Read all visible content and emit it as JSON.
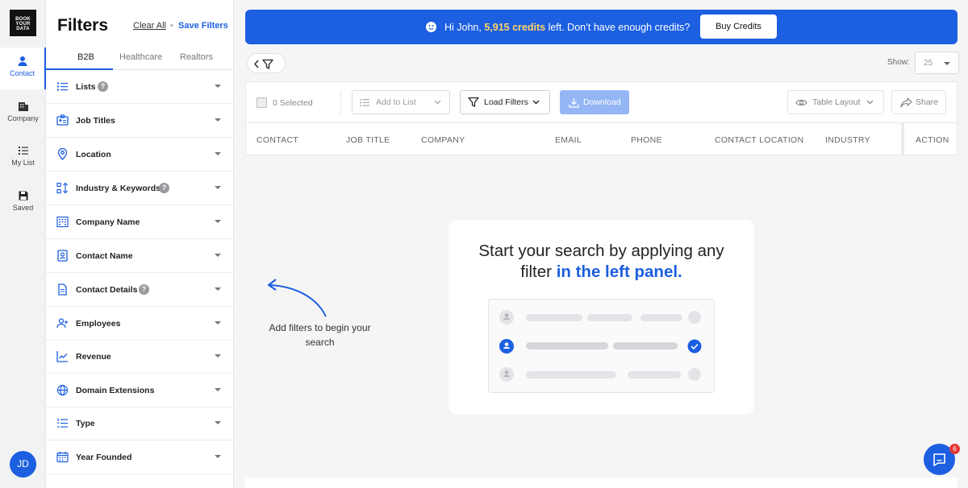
{
  "logo": {
    "text": "BOOK YOUR DATA"
  },
  "rail": {
    "items": [
      {
        "label": "Contact"
      },
      {
        "label": "Company"
      },
      {
        "label": "My List"
      },
      {
        "label": "Saved"
      }
    ],
    "avatar": "JD"
  },
  "filters": {
    "title": "Filters",
    "clear_all": "Clear All",
    "separator": "•",
    "save": "Save Filters",
    "tabs": [
      "B2B",
      "Healthcare",
      "Realtors"
    ],
    "items": [
      {
        "label": "Lists",
        "help": "?"
      },
      {
        "label": "Job Titles"
      },
      {
        "label": "Location"
      },
      {
        "label": "Industry & Keywords",
        "help": "?"
      },
      {
        "label": "Company Name"
      },
      {
        "label": "Contact Name"
      },
      {
        "label": "Contact Details",
        "help": "?"
      },
      {
        "label": "Employees"
      },
      {
        "label": "Revenue"
      },
      {
        "label": "Domain Extensions"
      },
      {
        "label": "Type"
      },
      {
        "label": "Year Founded"
      }
    ]
  },
  "banner": {
    "greeting": "Hi John, ",
    "credits": "5,915 credits",
    "tail": " left. Don’t have enough credits?",
    "buy": "Buy Credits"
  },
  "pager": {
    "show_label": "Show:",
    "show_value": "25"
  },
  "toolbar": {
    "selected": "0 Selected",
    "add_to_list": "Add to List",
    "load_filters": "Load Filters",
    "download": "Download",
    "table_layout": "Table Layout",
    "share": "Share"
  },
  "columns": [
    "CONTACT",
    "JOB TITLE",
    "COMPANY",
    "EMAIL",
    "PHONE",
    "CONTACT LOCATION",
    "INDUSTRY",
    "ACTION"
  ],
  "empty": {
    "line1": "Start your search by applying any",
    "line2a": "filter ",
    "line2b": "in the left panel."
  },
  "hint": "Add filters to begin your search",
  "chat": {
    "badge": "6"
  },
  "colors": {
    "accent": "#1c5fe0",
    "credits": "#ffd46b"
  }
}
